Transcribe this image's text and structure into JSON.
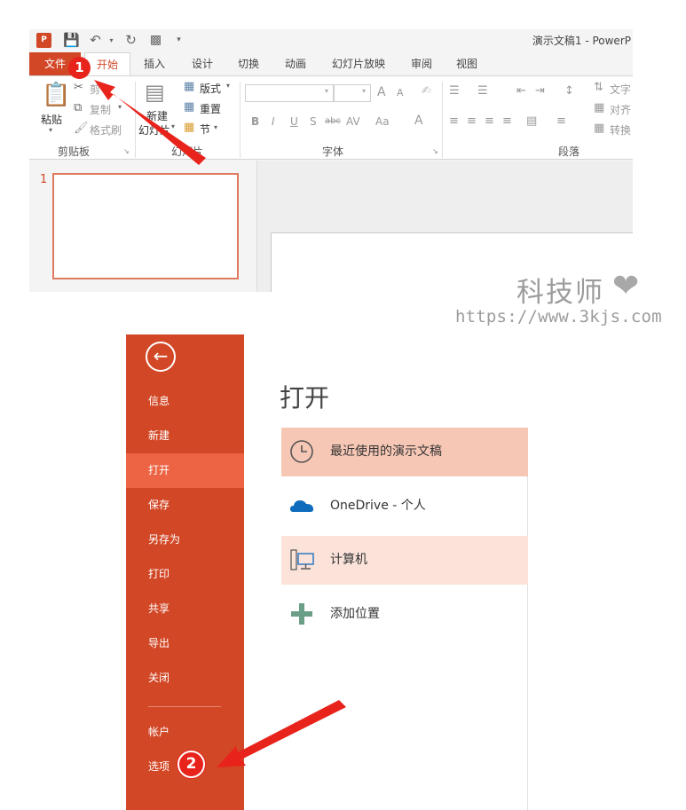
{
  "ribbon": {
    "app_logo": "P",
    "qat_icons": [
      "app-logo",
      "save-icon",
      "undo-icon",
      "redo-icon",
      "present-icon"
    ],
    "window_title": "演示文稿1 - PowerP",
    "tabs": [
      {
        "label": "文件"
      },
      {
        "label": "开始"
      },
      {
        "label": "插入"
      },
      {
        "label": "设计"
      },
      {
        "label": "切换"
      },
      {
        "label": "动画"
      },
      {
        "label": "幻灯片放映"
      },
      {
        "label": "审阅"
      },
      {
        "label": "视图"
      }
    ],
    "clipboard": {
      "paste": "粘贴",
      "cut": "剪",
      "copy": "复制",
      "format_painter": "格式刷",
      "label": "剪贴板"
    },
    "slides": {
      "new_slide_line1": "新建",
      "new_slide_line2": "幻灯片",
      "layout": "版式",
      "reset": "重置",
      "section": "节",
      "label": "幻灯片"
    },
    "font": {
      "bold": "B",
      "italic": "I",
      "underline": "U",
      "shadow": "S",
      "strike": "abc",
      "spacing": "AV",
      "case": "Aa",
      "color": "A",
      "grow": "A",
      "shrink": "A",
      "label": "字体"
    },
    "paragraph": {
      "text_direction": "文字",
      "align_text": "对齐",
      "convert": "转换",
      "label": "段落"
    },
    "slide_number": "1"
  },
  "watermark": {
    "title": "科技师",
    "url": "https://www.3kjs.com"
  },
  "backstage": {
    "nav": [
      {
        "label": "信息"
      },
      {
        "label": "新建"
      },
      {
        "label": "打开"
      },
      {
        "label": "保存"
      },
      {
        "label": "另存为"
      },
      {
        "label": "打印"
      },
      {
        "label": "共享"
      },
      {
        "label": "导出"
      },
      {
        "label": "关闭"
      },
      {
        "label": "帐户"
      },
      {
        "label": "选项"
      }
    ],
    "active_item": "打开",
    "title": "打开",
    "places": [
      {
        "label": "最近使用的演示文稿",
        "icon": "clock-icon"
      },
      {
        "label": "OneDrive - 个人",
        "icon": "cloud-icon"
      },
      {
        "label": "计算机",
        "icon": "computer-icon"
      },
      {
        "label": "添加位置",
        "icon": "plus-icon"
      }
    ]
  },
  "annotations": {
    "step1": "1",
    "step2": "2"
  },
  "colors": {
    "accent": "#d24726",
    "active_nav": "#ec6443",
    "selected_place": "#f7c7b5",
    "hover_place": "#fbe3da",
    "annotation": "#e8231b"
  }
}
